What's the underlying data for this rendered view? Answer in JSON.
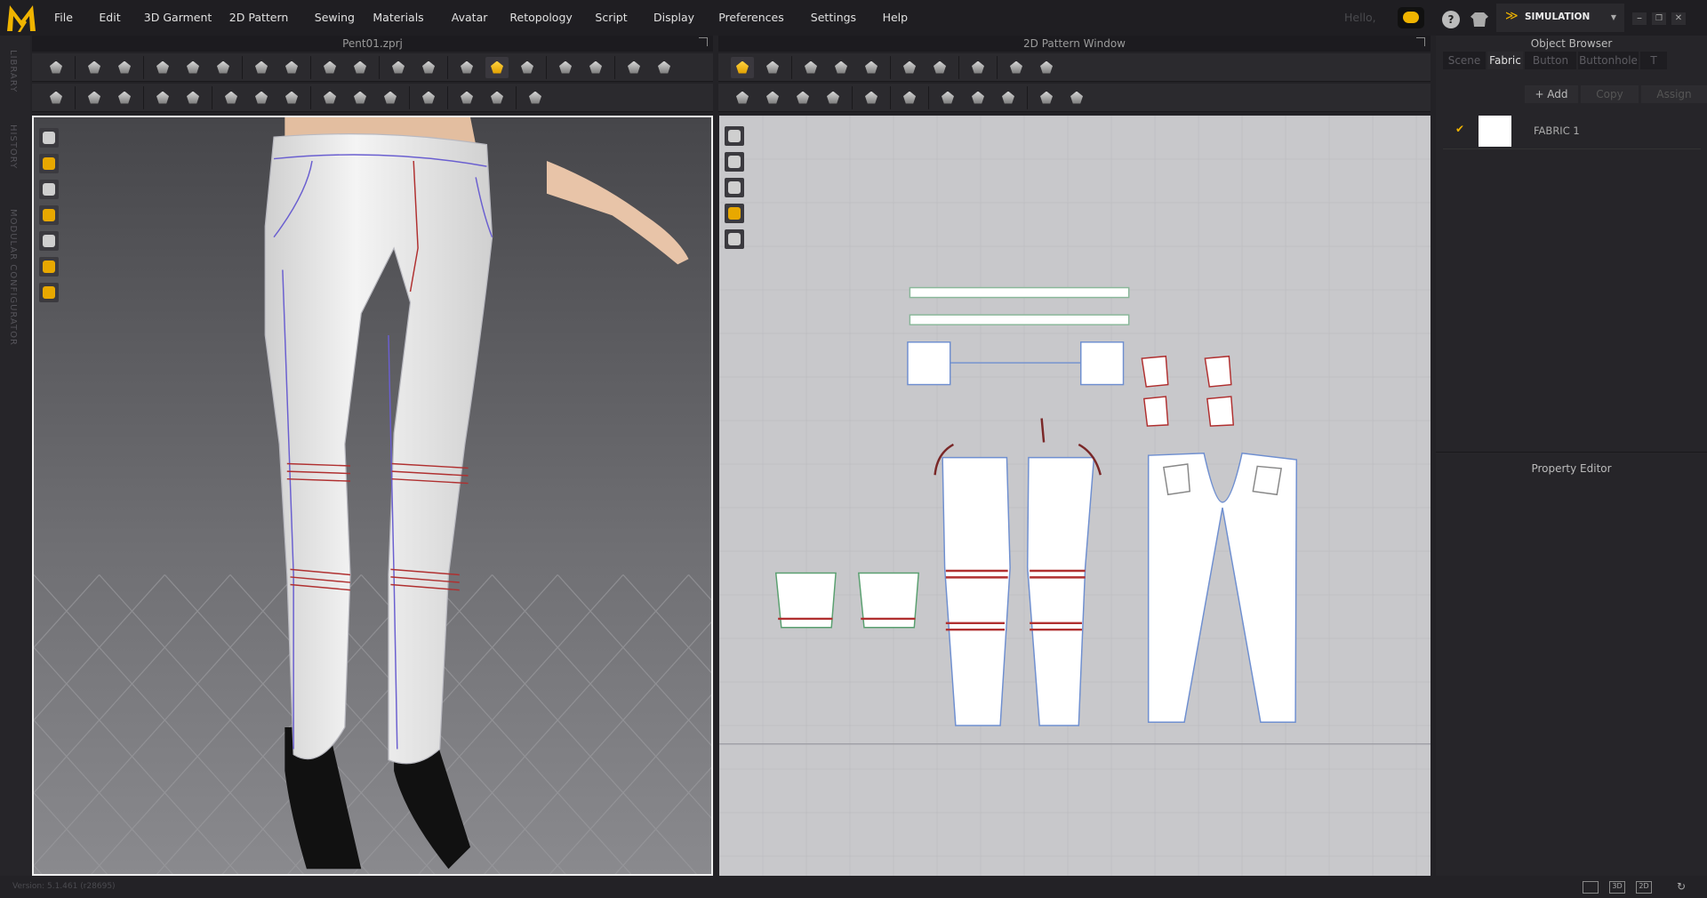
{
  "app": {
    "logo": "M"
  },
  "menu": [
    "File",
    "Edit",
    "3D Garment",
    "2D Pattern",
    "Sewing",
    "Materials",
    "Avatar",
    "Retopology",
    "Script",
    "Display",
    "Preferences",
    "Settings",
    "Help"
  ],
  "header": {
    "greeting": "Hello,",
    "mode": "SIMULATION",
    "icons": [
      "cloud-icon",
      "help-icon",
      "add-garment-icon",
      "simulation-icon",
      "dropdown-icon",
      "minimize-icon",
      "restore-icon",
      "close-icon"
    ]
  },
  "left_strip": [
    "LIBRARY",
    "HISTORY",
    "MODULAR CONFIGURATOR"
  ],
  "window3d": {
    "title": "Pent01.zprj",
    "row1": [
      "simulate",
      "|",
      "transform-pattern",
      "edit-pattern",
      "|",
      "segment-sew",
      "free-sew",
      "edit-sewing",
      "|",
      "tack",
      "pin",
      "|",
      "fold-arrange",
      "fold",
      "|",
      "select-mesh",
      "select-vertex",
      "|",
      "arrangement-points",
      "show-avatar-active",
      "show-garment",
      "|",
      "strengthen",
      "un-strengthen",
      "|",
      "select-grid",
      "edit-grid"
    ],
    "row2": [
      "avatar-pose",
      "|",
      "select-pattern",
      "tape",
      "|",
      "edit-tape",
      "free-tape",
      "|",
      "puckering",
      "fold-3d",
      "shrink",
      "|",
      "button",
      "buttonhole",
      "select-button",
      "|",
      "zipper",
      "|",
      "topstitch",
      "edit-topstitch",
      "|",
      "measure"
    ],
    "side_tools": [
      "show-avatar",
      "show-garment",
      "avatar-display",
      "texture",
      "fabric-render",
      "skin",
      "xray"
    ]
  },
  "window2d": {
    "title": "2D Pattern Window",
    "row1": [
      "transform-pattern",
      "edit-pattern",
      "|",
      "polygon",
      "rectangle",
      "ellipse",
      "|",
      "internal",
      "trace",
      "|",
      "cut",
      "|",
      "grid-select",
      "grid-edit"
    ],
    "row2": [
      "segment-sew",
      "free-sew",
      "edit-sewing",
      "m-n-sew",
      "|",
      "fold",
      "|",
      "graphic",
      "|",
      "select-texture",
      "texture-edit",
      "show-texture",
      "|",
      "line-sew",
      "dash-line"
    ],
    "side_tools": [
      "pencil",
      "garment",
      "info",
      "texture",
      "color"
    ]
  },
  "object_browser": {
    "title": "Object Browser",
    "tabs": [
      "Scene",
      "Fabric",
      "Button",
      "Buttonhole",
      "T"
    ],
    "active_tab": "Fabric",
    "buttons": {
      "add": "+ Add",
      "copy": "Copy",
      "assign": "Assign"
    },
    "items": [
      {
        "name": "FABRIC 1",
        "checked": true,
        "swatch": "#ffffff"
      }
    ]
  },
  "property_editor": {
    "title": "Property Editor"
  },
  "status": {
    "version": "Version: 5.1.461 (r28695)",
    "view_buttons": [
      "single-view",
      "3D",
      "2D"
    ]
  },
  "colors": {
    "accent": "#f0b400",
    "sew_red": "#b03030",
    "sew_blue": "#6f8fd0",
    "outline": "#5a4fc8"
  }
}
